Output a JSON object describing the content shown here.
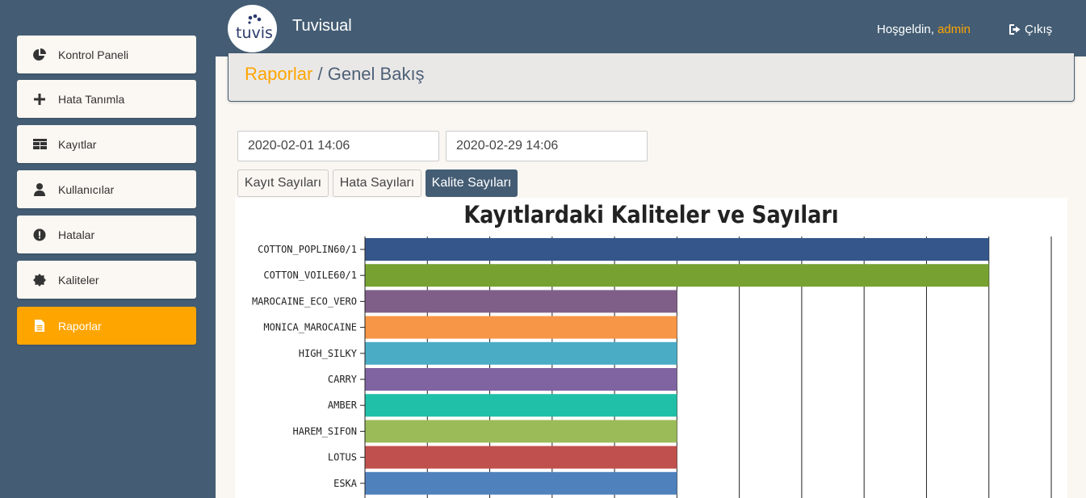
{
  "sidebar": {
    "items": [
      {
        "label": "Kontrol Paneli",
        "icon": "pie-chart-icon",
        "active": false
      },
      {
        "label": "Hata Tanımla",
        "icon": "plus-icon",
        "active": false
      },
      {
        "label": "Kayıtlar",
        "icon": "table-icon",
        "active": false
      },
      {
        "label": "Kullanıcılar",
        "icon": "user-icon",
        "active": false
      },
      {
        "label": "Hatalar",
        "icon": "exclamation-icon",
        "active": false
      },
      {
        "label": "Kaliteler",
        "icon": "certificate-icon",
        "active": false
      },
      {
        "label": "Raporlar",
        "icon": "file-icon",
        "active": true
      }
    ]
  },
  "header": {
    "logo_text": "tuvis",
    "app_title": "Tuvisual",
    "welcome_prefix": "Hoşgeldin,",
    "username": "admin",
    "logout_label": "Çıkış"
  },
  "breadcrumb": {
    "root": "Raporlar",
    "separator": " / ",
    "current": "Genel Bakış"
  },
  "filters": {
    "start_date": "2020-02-01 14:06",
    "end_date": "2020-02-29 14:06"
  },
  "tabs": [
    {
      "label": "Kayıt Sayıları",
      "active": false
    },
    {
      "label": "Hata Sayıları",
      "active": false
    },
    {
      "label": "Kalite Sayıları",
      "active": true
    }
  ],
  "colors": {
    "accent": "#ffa500",
    "primary": "#445d74"
  },
  "chart_data": {
    "type": "bar",
    "orientation": "horizontal",
    "title": "Kayıtlardaki Kaliteler ve Sayıları",
    "categories": [
      "COTTON_POPLIN60/1",
      "COTTON_VOILE60/1",
      "MAROCAINE_ECO_VERO",
      "MONICA_MAROCAINE",
      "HIGH_SILKY",
      "CARRY",
      "AMBER",
      "HAREM_SIFON",
      "LOTUS",
      "ESKA"
    ],
    "values": [
      2,
      2,
      1,
      1,
      1,
      1,
      1,
      1,
      1,
      1
    ],
    "colors": [
      "#34568b",
      "#77a232",
      "#7f5f88",
      "#f79646",
      "#4aacc5",
      "#8064a2",
      "#20c0a8",
      "#9bbb59",
      "#c0504d",
      "#4f81bd"
    ],
    "xlim": [
      0,
      2.2
    ],
    "grid": true
  }
}
